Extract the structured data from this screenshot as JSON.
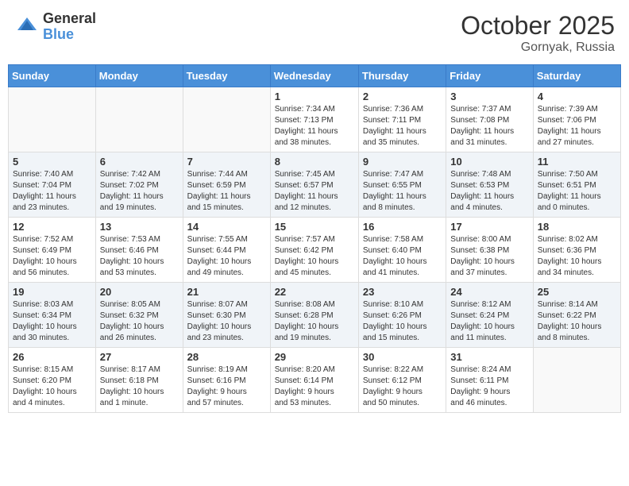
{
  "header": {
    "logo_general": "General",
    "logo_blue": "Blue",
    "month": "October 2025",
    "location": "Gornyak, Russia"
  },
  "weekdays": [
    "Sunday",
    "Monday",
    "Tuesday",
    "Wednesday",
    "Thursday",
    "Friday",
    "Saturday"
  ],
  "weeks": [
    [
      {
        "day": "",
        "info": ""
      },
      {
        "day": "",
        "info": ""
      },
      {
        "day": "",
        "info": ""
      },
      {
        "day": "1",
        "info": "Sunrise: 7:34 AM\nSunset: 7:13 PM\nDaylight: 11 hours\nand 38 minutes."
      },
      {
        "day": "2",
        "info": "Sunrise: 7:36 AM\nSunset: 7:11 PM\nDaylight: 11 hours\nand 35 minutes."
      },
      {
        "day": "3",
        "info": "Sunrise: 7:37 AM\nSunset: 7:08 PM\nDaylight: 11 hours\nand 31 minutes."
      },
      {
        "day": "4",
        "info": "Sunrise: 7:39 AM\nSunset: 7:06 PM\nDaylight: 11 hours\nand 27 minutes."
      }
    ],
    [
      {
        "day": "5",
        "info": "Sunrise: 7:40 AM\nSunset: 7:04 PM\nDaylight: 11 hours\nand 23 minutes."
      },
      {
        "day": "6",
        "info": "Sunrise: 7:42 AM\nSunset: 7:02 PM\nDaylight: 11 hours\nand 19 minutes."
      },
      {
        "day": "7",
        "info": "Sunrise: 7:44 AM\nSunset: 6:59 PM\nDaylight: 11 hours\nand 15 minutes."
      },
      {
        "day": "8",
        "info": "Sunrise: 7:45 AM\nSunset: 6:57 PM\nDaylight: 11 hours\nand 12 minutes."
      },
      {
        "day": "9",
        "info": "Sunrise: 7:47 AM\nSunset: 6:55 PM\nDaylight: 11 hours\nand 8 minutes."
      },
      {
        "day": "10",
        "info": "Sunrise: 7:48 AM\nSunset: 6:53 PM\nDaylight: 11 hours\nand 4 minutes."
      },
      {
        "day": "11",
        "info": "Sunrise: 7:50 AM\nSunset: 6:51 PM\nDaylight: 11 hours\nand 0 minutes."
      }
    ],
    [
      {
        "day": "12",
        "info": "Sunrise: 7:52 AM\nSunset: 6:49 PM\nDaylight: 10 hours\nand 56 minutes."
      },
      {
        "day": "13",
        "info": "Sunrise: 7:53 AM\nSunset: 6:46 PM\nDaylight: 10 hours\nand 53 minutes."
      },
      {
        "day": "14",
        "info": "Sunrise: 7:55 AM\nSunset: 6:44 PM\nDaylight: 10 hours\nand 49 minutes."
      },
      {
        "day": "15",
        "info": "Sunrise: 7:57 AM\nSunset: 6:42 PM\nDaylight: 10 hours\nand 45 minutes."
      },
      {
        "day": "16",
        "info": "Sunrise: 7:58 AM\nSunset: 6:40 PM\nDaylight: 10 hours\nand 41 minutes."
      },
      {
        "day": "17",
        "info": "Sunrise: 8:00 AM\nSunset: 6:38 PM\nDaylight: 10 hours\nand 37 minutes."
      },
      {
        "day": "18",
        "info": "Sunrise: 8:02 AM\nSunset: 6:36 PM\nDaylight: 10 hours\nand 34 minutes."
      }
    ],
    [
      {
        "day": "19",
        "info": "Sunrise: 8:03 AM\nSunset: 6:34 PM\nDaylight: 10 hours\nand 30 minutes."
      },
      {
        "day": "20",
        "info": "Sunrise: 8:05 AM\nSunset: 6:32 PM\nDaylight: 10 hours\nand 26 minutes."
      },
      {
        "day": "21",
        "info": "Sunrise: 8:07 AM\nSunset: 6:30 PM\nDaylight: 10 hours\nand 23 minutes."
      },
      {
        "day": "22",
        "info": "Sunrise: 8:08 AM\nSunset: 6:28 PM\nDaylight: 10 hours\nand 19 minutes."
      },
      {
        "day": "23",
        "info": "Sunrise: 8:10 AM\nSunset: 6:26 PM\nDaylight: 10 hours\nand 15 minutes."
      },
      {
        "day": "24",
        "info": "Sunrise: 8:12 AM\nSunset: 6:24 PM\nDaylight: 10 hours\nand 11 minutes."
      },
      {
        "day": "25",
        "info": "Sunrise: 8:14 AM\nSunset: 6:22 PM\nDaylight: 10 hours\nand 8 minutes."
      }
    ],
    [
      {
        "day": "26",
        "info": "Sunrise: 8:15 AM\nSunset: 6:20 PM\nDaylight: 10 hours\nand 4 minutes."
      },
      {
        "day": "27",
        "info": "Sunrise: 8:17 AM\nSunset: 6:18 PM\nDaylight: 10 hours\nand 1 minute."
      },
      {
        "day": "28",
        "info": "Sunrise: 8:19 AM\nSunset: 6:16 PM\nDaylight: 9 hours\nand 57 minutes."
      },
      {
        "day": "29",
        "info": "Sunrise: 8:20 AM\nSunset: 6:14 PM\nDaylight: 9 hours\nand 53 minutes."
      },
      {
        "day": "30",
        "info": "Sunrise: 8:22 AM\nSunset: 6:12 PM\nDaylight: 9 hours\nand 50 minutes."
      },
      {
        "day": "31",
        "info": "Sunrise: 8:24 AM\nSunset: 6:11 PM\nDaylight: 9 hours\nand 46 minutes."
      },
      {
        "day": "",
        "info": ""
      }
    ]
  ]
}
